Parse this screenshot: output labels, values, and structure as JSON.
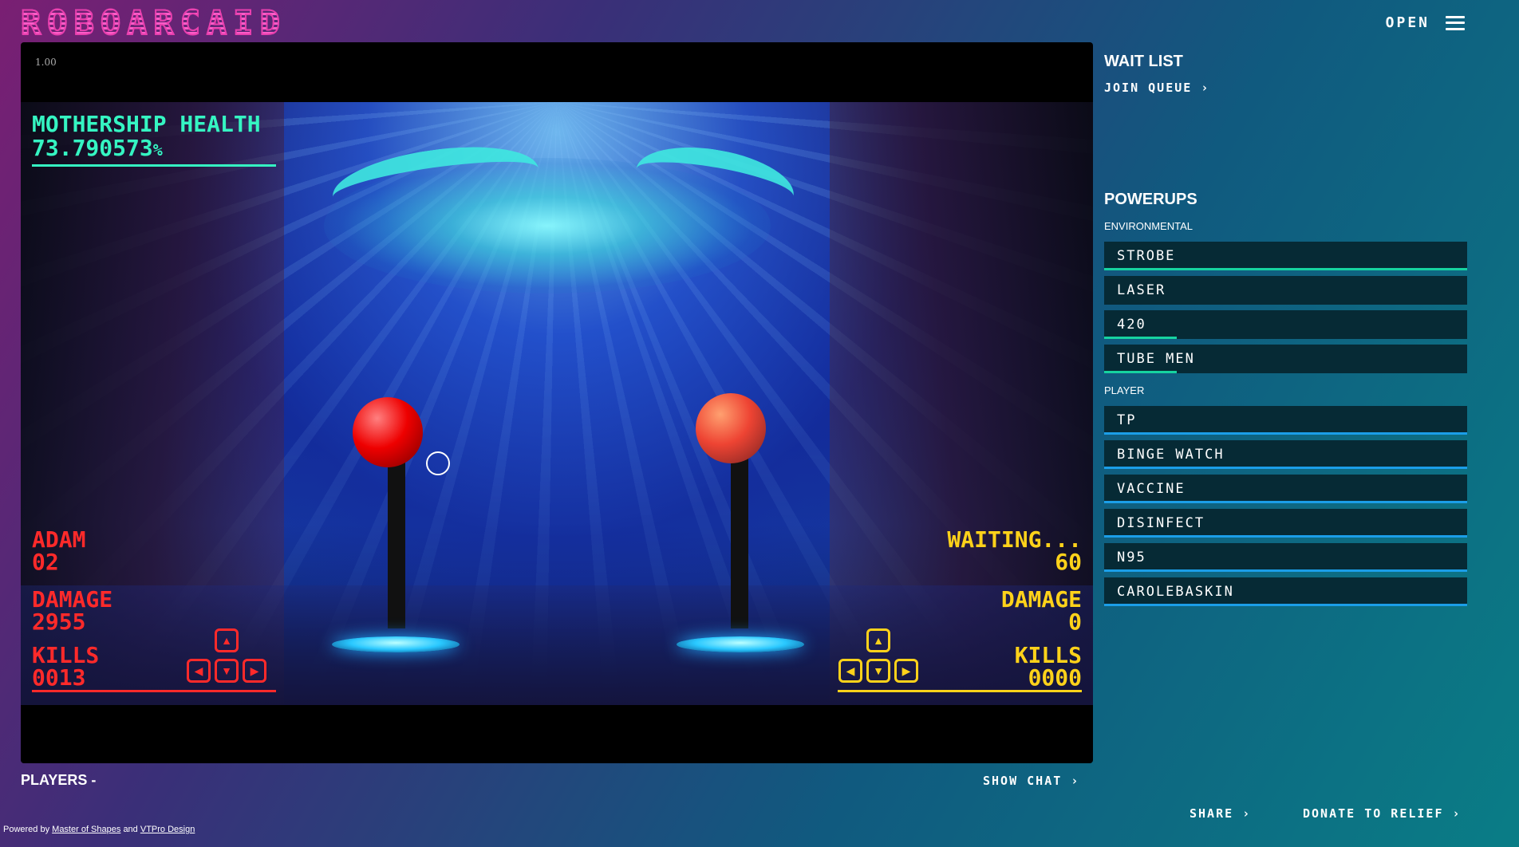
{
  "app": {
    "logo": "ROBOARCAID",
    "menu_label": "OPEN"
  },
  "video": {
    "speed": "1.00",
    "mothership_label": "MOTHERSHIP HEALTH",
    "mothership_value": "73.790573",
    "mothership_unit": "%",
    "player1": {
      "name": "ADAM",
      "number": "02",
      "damage_label": "DAMAGE",
      "damage": "2955",
      "kills_label": "KILLS",
      "kills": "0013"
    },
    "player2": {
      "name": "WAITING...",
      "number": "60",
      "damage_label": "DAMAGE",
      "damage": "0",
      "kills_label": "KILLS",
      "kills": "0000"
    }
  },
  "sidebar": {
    "waitlist_title": "WAIT LIST",
    "join_label": "JOIN QUEUE",
    "powerups_title": "POWERUPS",
    "env_label": "ENVIRONMENTAL",
    "env_items": [
      {
        "label": "STROBE",
        "progress": 1.0
      },
      {
        "label": "LASER",
        "progress": 0
      },
      {
        "label": "420",
        "progress": 0.2
      },
      {
        "label": "TUBE MEN",
        "progress": 0.2
      }
    ],
    "player_label": "PLAYER",
    "player_items": [
      {
        "label": "TP",
        "progress": 1.0
      },
      {
        "label": "BINGE WATCH",
        "progress": 1.0
      },
      {
        "label": "VACCINE",
        "progress": 1.0
      },
      {
        "label": "DISINFECT",
        "progress": 1.0
      },
      {
        "label": "N95",
        "progress": 1.0
      },
      {
        "label": "CAROLEBASKIN",
        "progress": 1.0
      }
    ],
    "env_color": "#16d3a0",
    "player_color": "#1b9ee8"
  },
  "bottom": {
    "players_label": "PLAYERS -",
    "chat_label": "SHOW CHAT",
    "share_label": "SHARE",
    "donate_label": "DONATE TO RELIEF"
  },
  "footer": {
    "prefix": "Powered by",
    "link1": "Master of Shapes",
    "middle": "and",
    "link2": "VTPro Design"
  },
  "icons": {
    "chevron": "chevron-right-icon",
    "menu": "hamburger-icon"
  }
}
